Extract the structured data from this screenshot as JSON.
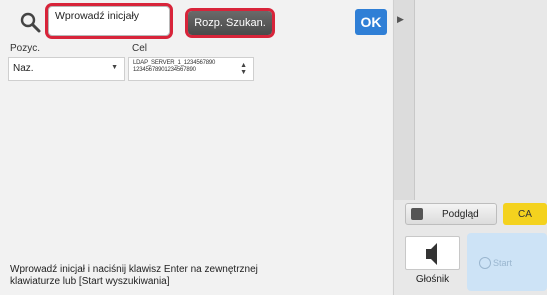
{
  "search": {
    "icon": "search-icon",
    "input_value": "Wprowadź inicjały",
    "start_button_label": "Rozp. Szukan.",
    "ok_label": "OK"
  },
  "columns": {
    "item_label": "Pozyc.",
    "target_label": "Cel"
  },
  "item_select": {
    "selected": "Naz."
  },
  "target_select": {
    "line1": "LDAP_SERVER_1_1234567890",
    "line2": "12345678901234567890"
  },
  "hint": "Wprowadź inicjał i naciśnij klawisz Enter na zewnętrznej klawiaturze lub [Start wyszukiwania]",
  "right_panel": {
    "preview_label": "Podgląd",
    "ca_label": "CA",
    "speaker_label": "Głośnik",
    "start_label": "Start"
  },
  "colors": {
    "highlight": "#d8243a",
    "ok_blue": "#2f7fd6",
    "ca_yellow": "#f4d21e"
  }
}
